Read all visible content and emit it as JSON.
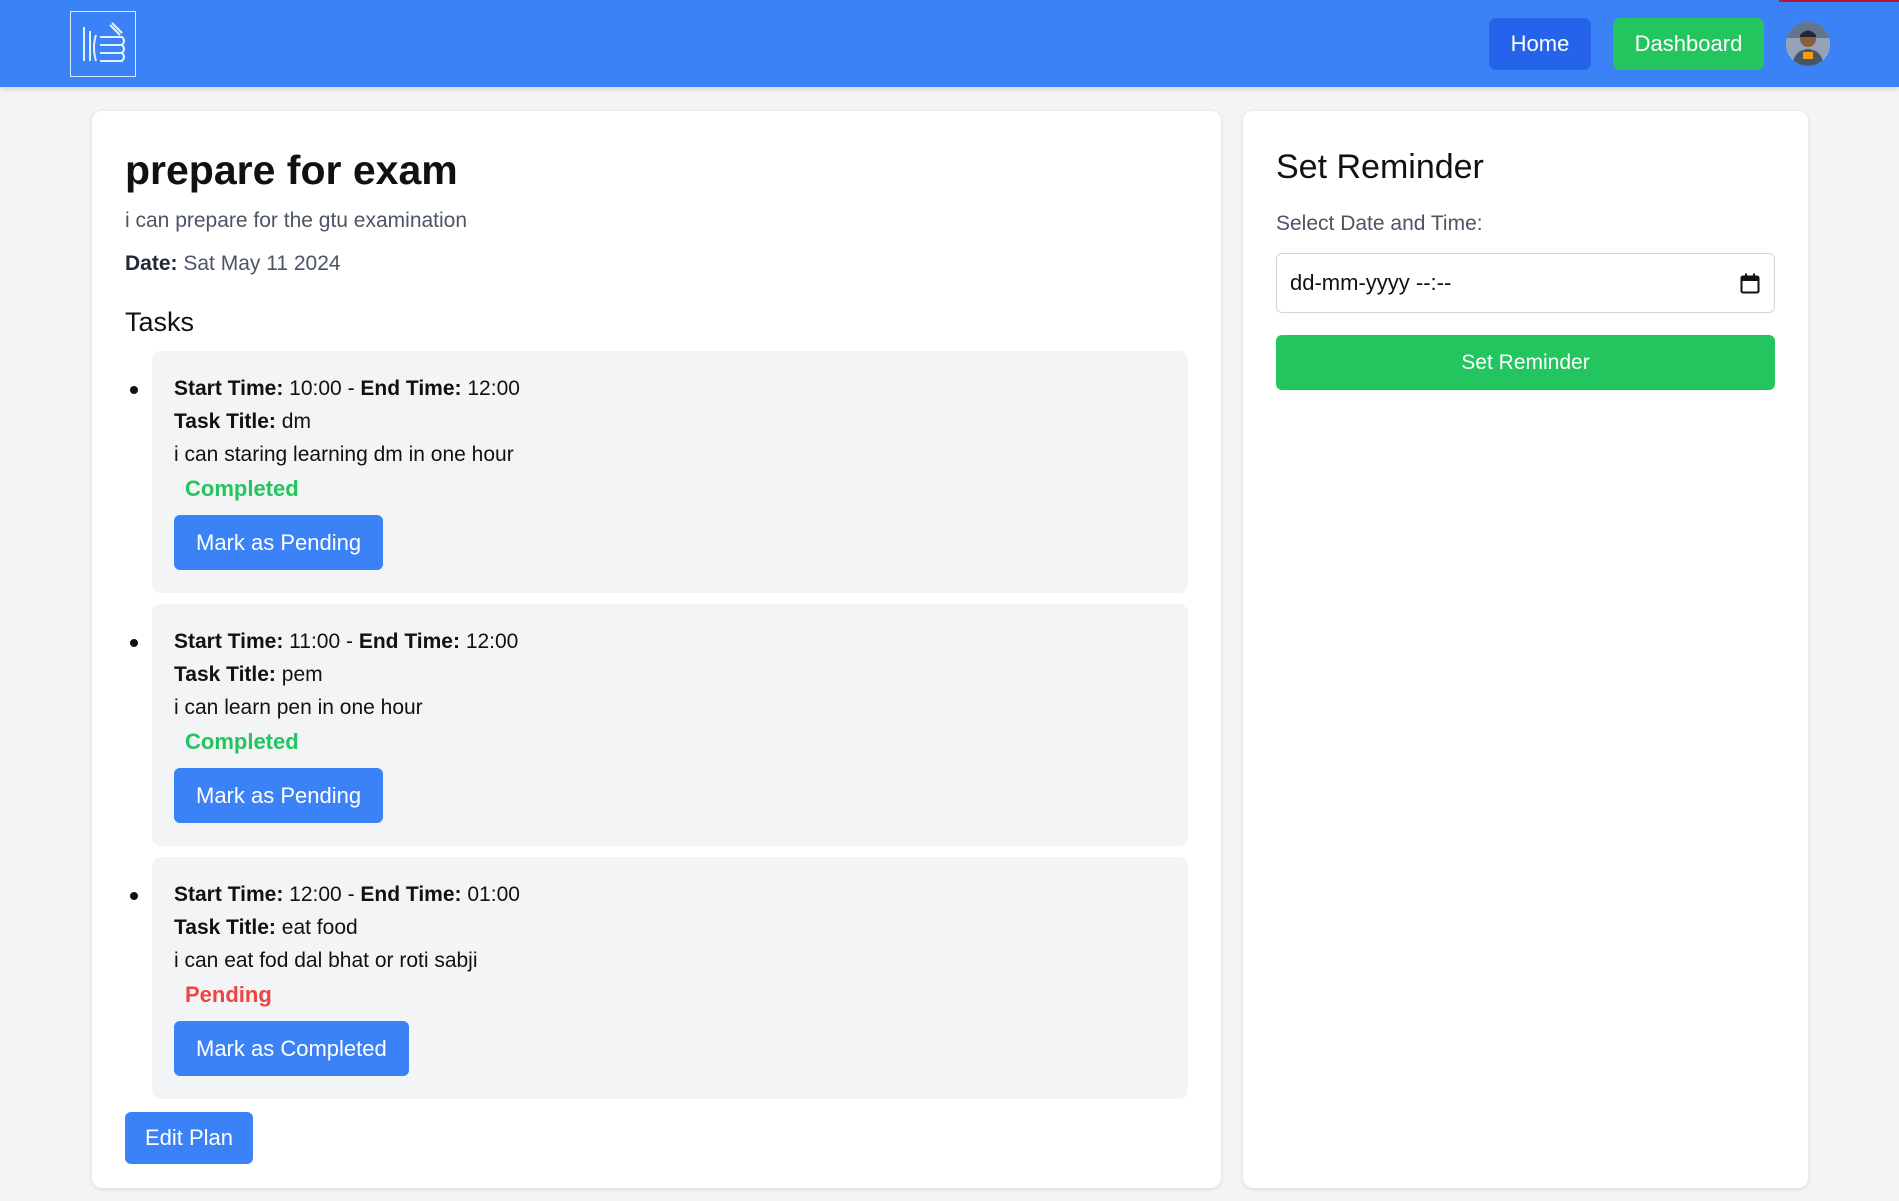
{
  "colors": {
    "navbar": "#3b82f6",
    "primary_button": "#3b82f6",
    "home_button": "#2563eb",
    "success": "#22c55e",
    "danger": "#ef4444",
    "page_bg": "#f3f4f6"
  },
  "header": {
    "logo_icon": "book-stack-icon",
    "home_label": "Home",
    "dashboard_label": "Dashboard",
    "avatar_icon": "user-avatar"
  },
  "plan": {
    "title": "prepare for exam",
    "description": "i can prepare for the gtu examination",
    "date_label": "Date:",
    "date_value": "Sat May 11 2024",
    "tasks_heading": "Tasks",
    "edit_label": "Edit Plan"
  },
  "task_labels": {
    "start": "Start Time:",
    "end": "End Time:",
    "separator": "-",
    "title": "Task Title:"
  },
  "tasks": [
    {
      "start": "10:00",
      "end": "12:00",
      "title": "dm",
      "description": "i can staring learning dm in one hour",
      "status": "Completed",
      "status_color": "#22c55e",
      "action": "Mark as Pending"
    },
    {
      "start": "11:00",
      "end": "12:00",
      "title": "pem",
      "description": "i can learn pen in one hour",
      "status": "Completed",
      "status_color": "#22c55e",
      "action": "Mark as Pending"
    },
    {
      "start": "12:00",
      "end": "01:00",
      "title": "eat food",
      "description": "i can eat fod dal bhat or roti sabji",
      "status": "Pending",
      "status_color": "#ef4444",
      "action": "Mark as Completed"
    }
  ],
  "reminder": {
    "title": "Set Reminder",
    "field_label": "Select Date and Time:",
    "placeholder": "dd-mm-yyyy --:--",
    "calendar_icon": "calendar-icon",
    "button_label": "Set Reminder"
  }
}
